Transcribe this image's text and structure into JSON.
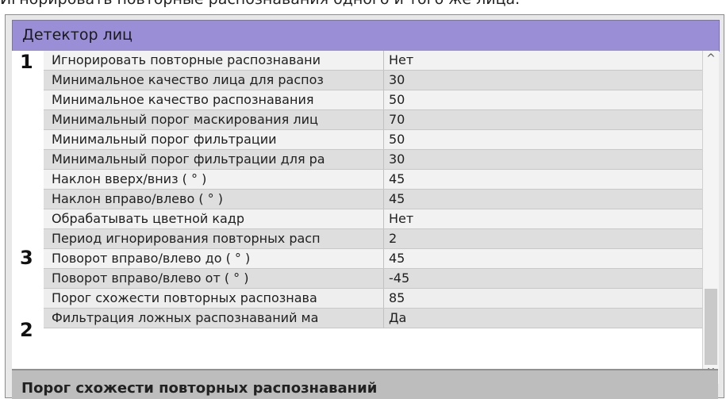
{
  "caption": "Игнорировать повторные распознавания одного и того же лица.",
  "panel": {
    "title": "Детектор лиц",
    "bottom_label": "Порог схожести повторных распознаваний"
  },
  "markers": [
    {
      "label": "1",
      "row": 0
    },
    {
      "label": "3",
      "row": 10
    },
    {
      "label": "2",
      "row": 13
    }
  ],
  "rows": [
    {
      "label": "Игнорировать повторные распознавани",
      "value": "Нет"
    },
    {
      "label": "Минимальное качество лица для распоз",
      "value": "30"
    },
    {
      "label": "Минимальное качество распознавания",
      "value": "50"
    },
    {
      "label": "Минимальный порог маскирования лиц",
      "value": "70"
    },
    {
      "label": "Минимальный порог фильтрации",
      "value": "50"
    },
    {
      "label": "Минимальный порог фильтрации для ра",
      "value": "30"
    },
    {
      "label": "Наклон вверх/вниз ( ° )",
      "value": "45"
    },
    {
      "label": "Наклон вправо/влево ( ° )",
      "value": "45"
    },
    {
      "label": "Обрабатывать цветной кадр",
      "value": "Нет"
    },
    {
      "label": "Период игнорирования повторных расп",
      "value": "2"
    },
    {
      "label": "Поворот вправо/влево до ( ° )",
      "value": "45"
    },
    {
      "label": "Поворот вправо/влево от ( ° )",
      "value": "-45"
    },
    {
      "label": "Порог схожести повторных распознава",
      "value": "85"
    },
    {
      "label": "Фильтрация ложных распознаваний ма",
      "value": "Да"
    }
  ],
  "scroll": {
    "up_icon": "chevron-up-icon",
    "down_icon": "chevron-down-icon"
  }
}
